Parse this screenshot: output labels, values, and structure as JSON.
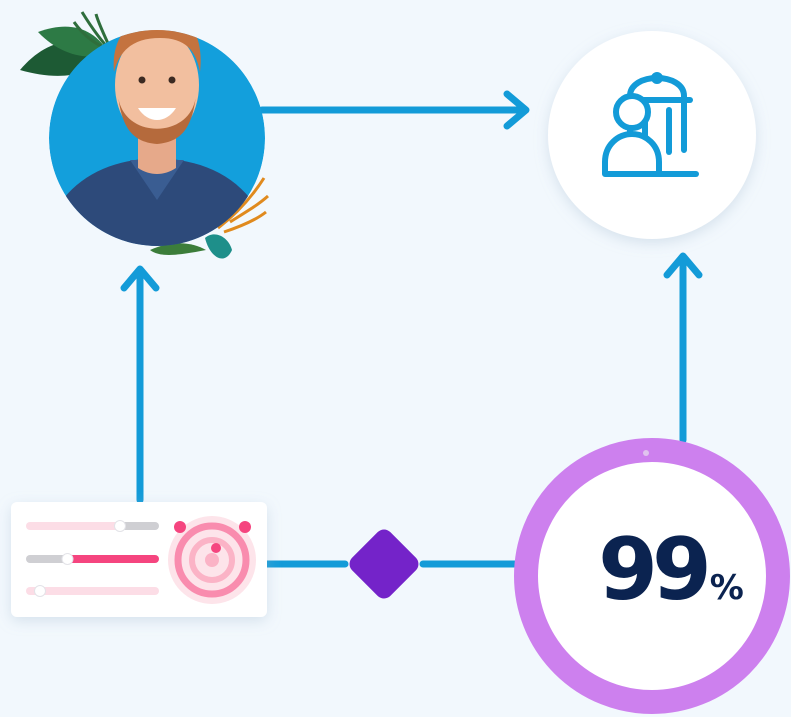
{
  "metric": {
    "value": "99",
    "unit": "%"
  },
  "colors": {
    "background": "#f2f8fd",
    "connector": "#139bd8",
    "diamond": "#7423c9",
    "ring": "#cd80ee",
    "metric_text": "#0b2350",
    "slider_track": "#cfcfd3",
    "slider_pink": "#fcdde6",
    "slider_active": "#f5457f"
  },
  "icons": [
    "user-building-icon",
    "dial-target-icon"
  ],
  "sliders": [
    {
      "level": 0.72
    },
    {
      "level": 0.3
    },
    {
      "level": 0.08
    }
  ]
}
